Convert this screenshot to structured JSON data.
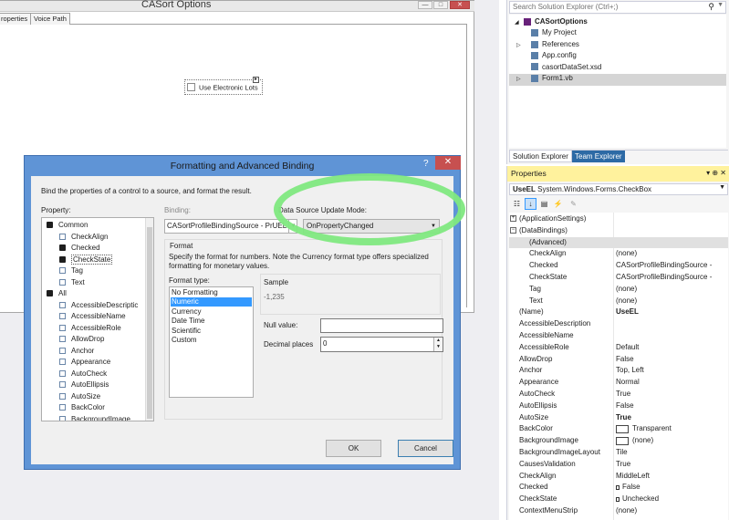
{
  "designer": {
    "form_title": "CASort Options",
    "tabs": [
      "roperties",
      "Voice Path"
    ],
    "checkbox_label": "Use Electronic Lots"
  },
  "dialog": {
    "title": "Formatting and Advanced Binding",
    "help": "?",
    "close": "✕",
    "description": "Bind the properties of a control to a source, and format the result.",
    "property_label": "Property:",
    "binding_label": "Binding:",
    "dsum_label": "Data Source Update Mode:",
    "binding_value": "CASortProfileBindingSource - PrUEL",
    "dsum_value": "OnPropertyChanged",
    "property_tree": [
      {
        "label": "Common",
        "kind": "group",
        "indent": 0
      },
      {
        "label": "CheckAlign",
        "kind": "prop",
        "indent": 1
      },
      {
        "label": "Checked",
        "kind": "bound",
        "indent": 1
      },
      {
        "label": "CheckState",
        "kind": "bound",
        "indent": 1,
        "selected": true
      },
      {
        "label": "Tag",
        "kind": "prop",
        "indent": 1
      },
      {
        "label": "Text",
        "kind": "prop",
        "indent": 1
      },
      {
        "label": "All",
        "kind": "group",
        "indent": 0
      },
      {
        "label": "AccessibleDescriptic",
        "kind": "prop",
        "indent": 1
      },
      {
        "label": "AccessibleName",
        "kind": "prop",
        "indent": 1
      },
      {
        "label": "AccessibleRole",
        "kind": "prop",
        "indent": 1
      },
      {
        "label": "AllowDrop",
        "kind": "prop",
        "indent": 1
      },
      {
        "label": "Anchor",
        "kind": "prop",
        "indent": 1
      },
      {
        "label": "Appearance",
        "kind": "prop",
        "indent": 1
      },
      {
        "label": "AutoCheck",
        "kind": "prop",
        "indent": 1
      },
      {
        "label": "AutoEllipsis",
        "kind": "prop",
        "indent": 1
      },
      {
        "label": "AutoSize",
        "kind": "prop",
        "indent": 1
      },
      {
        "label": "BackColor",
        "kind": "prop",
        "indent": 1
      },
      {
        "label": "BackgroundImage",
        "kind": "prop",
        "indent": 1
      }
    ],
    "format_label": "Format",
    "format_description": "Specify the format for numbers. Note the Currency format type offers specialized formatting for monetary values.",
    "format_type_label": "Format type:",
    "format_types": [
      "No Formatting",
      "Numeric",
      "Currency",
      "Date Time",
      "Scientific",
      "Custom"
    ],
    "format_selected": 1,
    "sample_label": "Sample",
    "sample_value": "-1,235",
    "null_value_label": "Null value:",
    "null_value": "",
    "decimal_places_label": "Decimal places",
    "decimal_places": "0",
    "ok_label": "OK",
    "cancel_label": "Cancel"
  },
  "solution_explorer": {
    "search_placeholder": "Search Solution Explorer (Ctrl+;)",
    "items": [
      {
        "label": "CASortOptions",
        "icon": "vb-project-icon",
        "indent": 0,
        "bold": true,
        "expander": "◢"
      },
      {
        "label": "My Project",
        "icon": "wrench-icon",
        "indent": 1,
        "expander": ""
      },
      {
        "label": "References",
        "icon": "references-icon",
        "indent": 1,
        "expander": "▷"
      },
      {
        "label": "App.config",
        "icon": "config-icon",
        "indent": 1,
        "expander": ""
      },
      {
        "label": "casortDataSet.xsd",
        "icon": "dataset-icon",
        "indent": 1,
        "expander": ""
      },
      {
        "label": "Form1.vb",
        "icon": "form-icon",
        "indent": 1,
        "expander": "▷",
        "selected": true
      }
    ],
    "tabs": [
      "Solution Explorer",
      "Team Explorer"
    ]
  },
  "properties": {
    "title": "Properties",
    "title_controls": "▾ ⊕ ✕",
    "object_name": "UseEL",
    "object_type": "System.Windows.Forms.CheckBox",
    "rows": [
      {
        "name": "(ApplicationSettings)",
        "value": "",
        "expander": "+",
        "level": 0
      },
      {
        "name": "(DataBindings)",
        "value": "",
        "expander": "−",
        "level": 0
      },
      {
        "name": "(Advanced)",
        "value": "",
        "level": 1,
        "selected": true
      },
      {
        "name": "CheckAlign",
        "value": "(none)",
        "level": 1
      },
      {
        "name": "Checked",
        "value": "CASortProfileBindingSource -",
        "level": 1
      },
      {
        "name": "CheckState",
        "value": "CASortProfileBindingSource -",
        "level": 1
      },
      {
        "name": "Tag",
        "value": "(none)",
        "level": 1
      },
      {
        "name": "Text",
        "value": "(none)",
        "level": 1
      },
      {
        "name": "(Name)",
        "value": "UseEL",
        "level": 0,
        "bold_value": true
      },
      {
        "name": "AccessibleDescription",
        "value": "",
        "level": 0
      },
      {
        "name": "AccessibleName",
        "value": "",
        "level": 0
      },
      {
        "name": "AccessibleRole",
        "value": "Default",
        "level": 0
      },
      {
        "name": "AllowDrop",
        "value": "False",
        "level": 0
      },
      {
        "name": "Anchor",
        "value": "Top, Left",
        "level": 0
      },
      {
        "name": "Appearance",
        "value": "Normal",
        "level": 0
      },
      {
        "name": "AutoCheck",
        "value": "True",
        "level": 0
      },
      {
        "name": "AutoEllipsis",
        "value": "False",
        "level": 0
      },
      {
        "name": "AutoSize",
        "value": "True",
        "level": 0,
        "bold_value": true
      },
      {
        "name": "BackColor",
        "value": "Transparent",
        "level": 0,
        "swatch": true
      },
      {
        "name": "BackgroundImage",
        "value": "(none)",
        "level": 0,
        "swatch": true
      },
      {
        "name": "BackgroundImageLayout",
        "value": "Tile",
        "level": 0
      },
      {
        "name": "CausesValidation",
        "value": "True",
        "level": 0
      },
      {
        "name": "CheckAlign",
        "value": "MiddleLeft",
        "level": 0
      },
      {
        "name": "Checked",
        "value": "False",
        "level": 0,
        "lock": true
      },
      {
        "name": "CheckState",
        "value": "Unchecked",
        "level": 0,
        "lock": true
      },
      {
        "name": "ContextMenuStrip",
        "value": "(none)",
        "level": 0
      }
    ]
  },
  "colors": {
    "dialog_border": "#5f94d6",
    "highlight": "#80e880",
    "properties_title": "#fff29d",
    "selection": "#3399ff"
  }
}
